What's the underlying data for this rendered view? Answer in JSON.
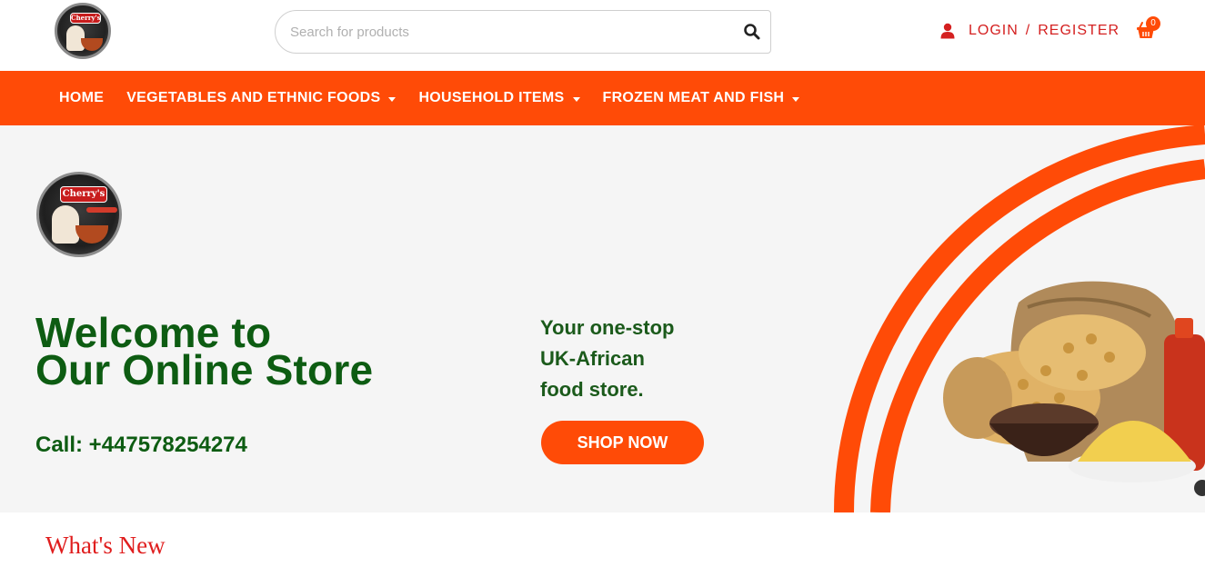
{
  "header": {
    "logo_alt": "Cherry's African Store",
    "search": {
      "placeholder": "Search for products",
      "value": ""
    },
    "login_label": "LOGIN",
    "login_separator": "/",
    "register_label": "REGISTER",
    "cart_count": "0"
  },
  "nav": {
    "items": [
      {
        "label": "HOME",
        "has_dropdown": false
      },
      {
        "label": "VEGETABLES AND ETHNIC FOODS",
        "has_dropdown": true
      },
      {
        "label": "HOUSEHOLD ITEMS",
        "has_dropdown": true
      },
      {
        "label": "FROZEN MEAT AND FISH",
        "has_dropdown": true
      }
    ]
  },
  "hero": {
    "logo_badge": "Cherry's",
    "welcome_line1": "Welcome to",
    "welcome_line2": "Our Online Store",
    "call": "Call: +447578254274",
    "tagline_line1": "Your one-stop",
    "tagline_line2": "UK-African",
    "tagline_line3": "food store.",
    "shop_button": "SHOP NOW"
  },
  "section": {
    "title": "What's New"
  },
  "colors": {
    "accent": "#ff4b07",
    "headline_green": "#0d5c12",
    "login_red": "#d42020",
    "section_red": "#e01e1e"
  }
}
